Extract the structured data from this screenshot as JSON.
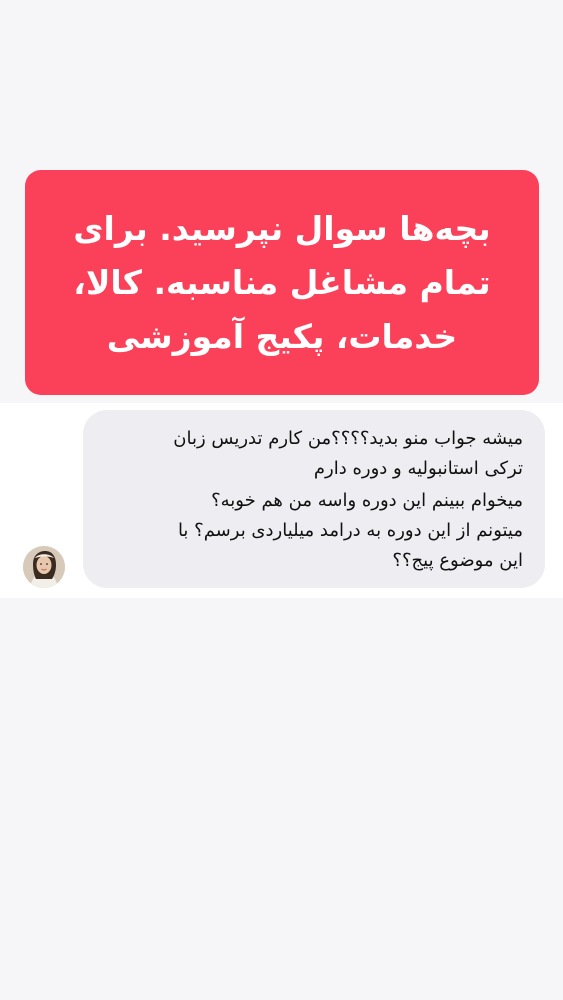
{
  "caption": {
    "text": "بچه‌ها سوال نپرسید. برای\nتمام مشاغل مناسبه. کالا،\nخدمات، پکیج آموزشی",
    "background_color": "#fb4159",
    "text_color": "#ffffff"
  },
  "message": {
    "lines": [
      "میشه جواب منو بدید؟؟؟؟من کارم تدریس زبان",
      "ترکی استانبولیه و دوره دارم",
      "میخوام ببینم این دوره واسه من هم خوبه؟",
      "میتونم از این دوره به درامد میلیاردی برسم؟ با",
      "این موضوع پیج؟؟"
    ],
    "bubble_color": "#eeeef2",
    "sender_avatar_icon": "avatar-icon"
  }
}
